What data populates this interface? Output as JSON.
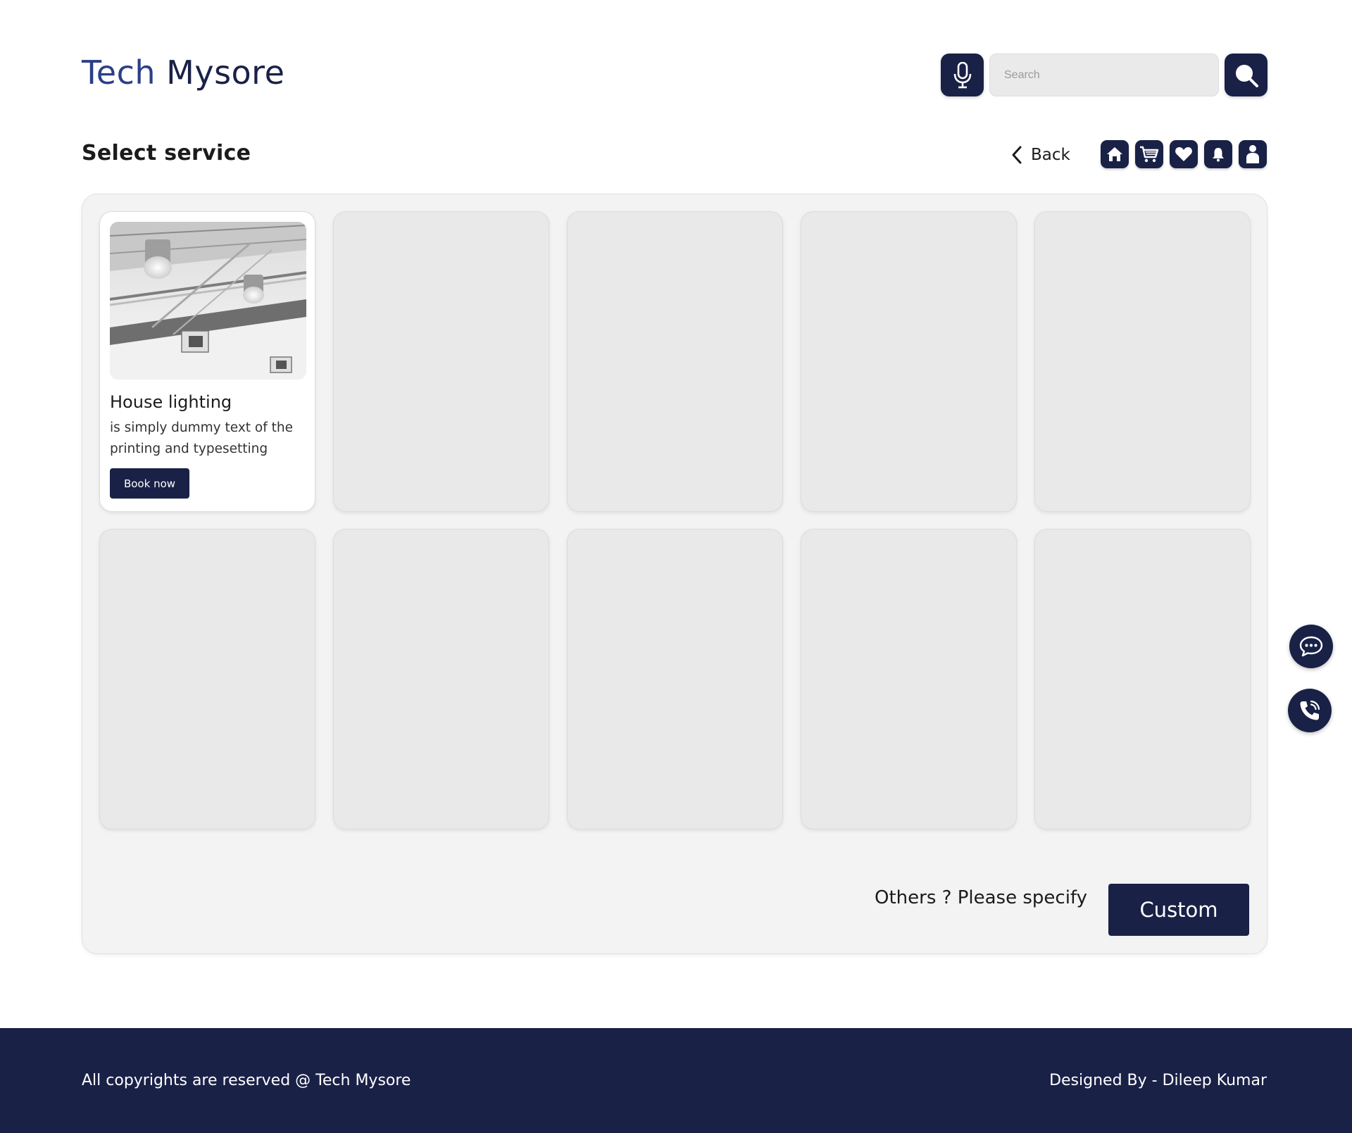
{
  "header": {
    "logo_part1": "Tech",
    "logo_part2": "Mysore",
    "search_placeholder": "Search",
    "mic_icon": "microphone-icon",
    "search_icon": "magnifier-icon"
  },
  "subheader": {
    "title": "Select service",
    "back_label": "Back",
    "icons": [
      "home-icon",
      "cart-icon",
      "heart-icon",
      "bell-icon",
      "user-icon"
    ]
  },
  "services": {
    "cards": [
      {
        "title": "House lighting",
        "description": "is simply dummy text of the printing and typesetting",
        "button": "Book now",
        "image": "ceiling-lights-photo"
      }
    ],
    "empty_slots": 9
  },
  "custom": {
    "prompt": "Others ? Please specify",
    "button": "Custom"
  },
  "floating": {
    "chat_icon": "chat-bubble-icon",
    "call_icon": "phone-call-icon"
  },
  "footer": {
    "left": "All copyrights are reserved @ Tech Mysore",
    "right": "Designed By - Dileep Kumar"
  },
  "colors": {
    "primary": "#1a2147",
    "logo_accent": "#2b3f86",
    "panel_bg": "#f3f3f3",
    "placeholder_card": "#e9e9e9"
  }
}
